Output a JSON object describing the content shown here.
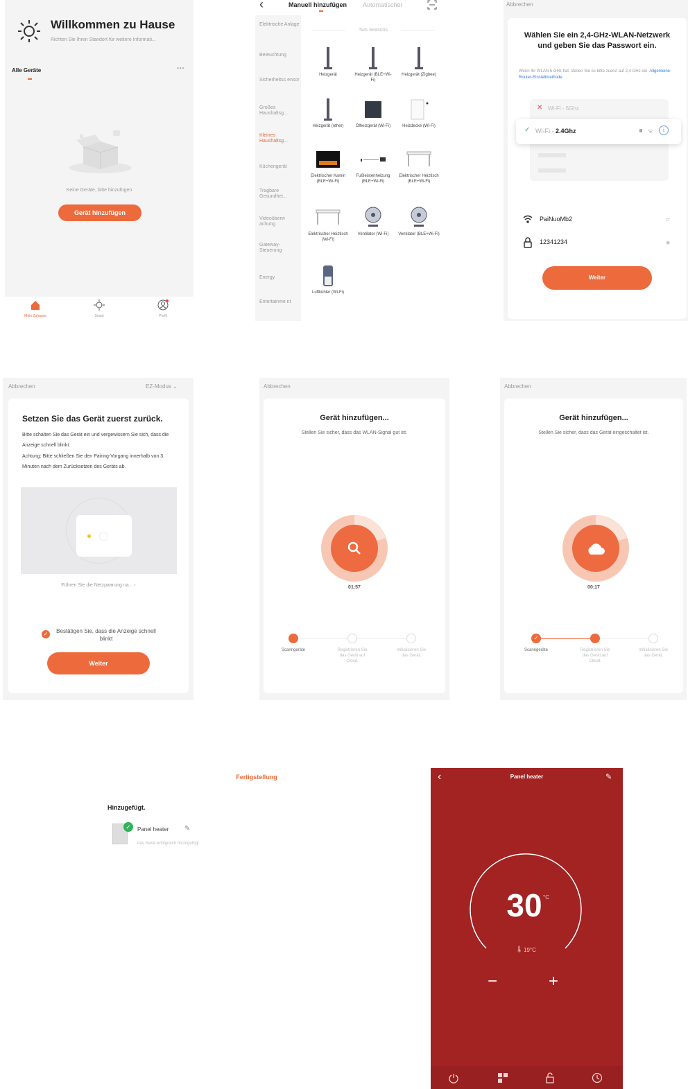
{
  "s1": {
    "title": "Willkommen zu Hause",
    "subtitle": "Richten Sie Ihren Standort für weitere Informati...",
    "tab_all": "Alle Geräte",
    "more": "···",
    "empty_text": "Keine Geräte, bitte hinzufügen",
    "add_button": "Gerät hinzufügen",
    "nav": [
      {
        "label": "Mein Zuhause",
        "icon": "home-icon"
      },
      {
        "label": "Smart",
        "icon": "smart-icon"
      },
      {
        "label": "Profil",
        "icon": "profile-icon"
      }
    ]
  },
  "s2": {
    "back": "‹",
    "tab_manual": "Manuell hinzufügen",
    "tab_auto": "Automatischer",
    "section": "Two Seasons",
    "sidebar": [
      "Elektrische Anlage",
      "Beleuchtung",
      "Sicherheitss ensor",
      "Großes Haushaltsg...",
      "Kleines Haushaltsg...",
      "Küchengerät",
      "Tragbare Gesundhei...",
      "Videoüberw achung",
      "Gateway-Steuerung",
      "Energy",
      "Entertainme nt"
    ],
    "active_index": 4,
    "devices": [
      "Heizgerät",
      "Heizgerät (BLE+Wi-Fi)",
      "Heizgerät (Zigbee)",
      "Heizgerät (other)",
      "Ölheizgerät (Wi-Fi)",
      "Heizdecke (Wi-Fi)",
      "Elektrischer Kamin (BLE+Wi-Fi)",
      "Fußleistenheizung (BLE+Wi-Fi)",
      "Elektrischer Heiztisch (BLE+Wi-Fi)",
      "Elektrischer Heiztisch (Wi-Fi)",
      "Ventilator (Wi-Fi)",
      "Ventilator (BLE+Wi-Fi)",
      "Luftkühler (Wi-Fi)"
    ]
  },
  "s3": {
    "cancel": "Abbrechen",
    "title": "Wählen Sie ein 2,4-GHz-WLAN-Netzwerk und geben Sie das Passwort ein.",
    "note": "Wenn Ihr WLAN 5 GHz hat, stellen Sie es bitte zuerst auf 2,4 GHz ein.",
    "link": "Allgemeine Router-Einstellmethode",
    "wifi5": "Wi-Fi - 5Ghz",
    "wifi24_prefix": "Wi-Fi - ",
    "wifi24_band": "2.4Ghz",
    "ssid": "PaiNuoMb2",
    "password": "12341234",
    "next": "Weiter"
  },
  "s4": {
    "cancel": "Abbrechen",
    "mode": "EZ-Modus",
    "title": "Setzen Sie das Gerät zuerst zurück.",
    "body": "Bitte schalten Sie das Gerät ein und vergewissern Sie sich, dass die Anzeige schnell blinkt.",
    "note": "Achtung: Bitte schließen Sie den Pairing-Vorgang innerhalb von 3 Minuten nach dem Zurücksetzen des Geräts ab.",
    "guide": "Führen Sie die Netzpaarung na...",
    "confirm": "Bestätigen Sie, dass die Anzeige schnell blinkt",
    "next": "Weiter"
  },
  "s5": {
    "cancel": "Abbrechen",
    "title": "Gerät hinzufügen...",
    "subtitle": "Stellen Sie sicher, dass das WLAN-Signal gut ist.",
    "timer": "01:57",
    "steps": [
      "Scanngeräte",
      "Registrieren Sie das Gerät auf Cloud.",
      "Initialisieren Sie das Gerät."
    ]
  },
  "s6": {
    "cancel": "Abbrechen",
    "title": "Gerät hinzufügen...",
    "subtitle": "Stellen Sie sicher, dass das Gerät eingeschaltet ist.",
    "timer": "00:17",
    "steps": [
      "Scanngeräte",
      "Registrieren Sie das Gerät auf Cloud.",
      "Initialisieren Sie das Gerät."
    ]
  },
  "s7": {
    "header": "Fertigstellung",
    "added": "Hinzugefügt.",
    "device_name": "Panel heater",
    "success": "das Gerät erfolgreich hinzugefügt"
  },
  "s8": {
    "title": "Panel heater",
    "setpoint": "30",
    "unit": "°C",
    "current": "19°C",
    "minus": "−",
    "plus": "+",
    "bottom_icons": [
      "power-icon",
      "mode-icon",
      "lock-icon",
      "timer-icon"
    ]
  },
  "colors": {
    "accent": "#ed6a3c",
    "heater_bg": "#a32222",
    "success_green": "#2fb35b"
  }
}
